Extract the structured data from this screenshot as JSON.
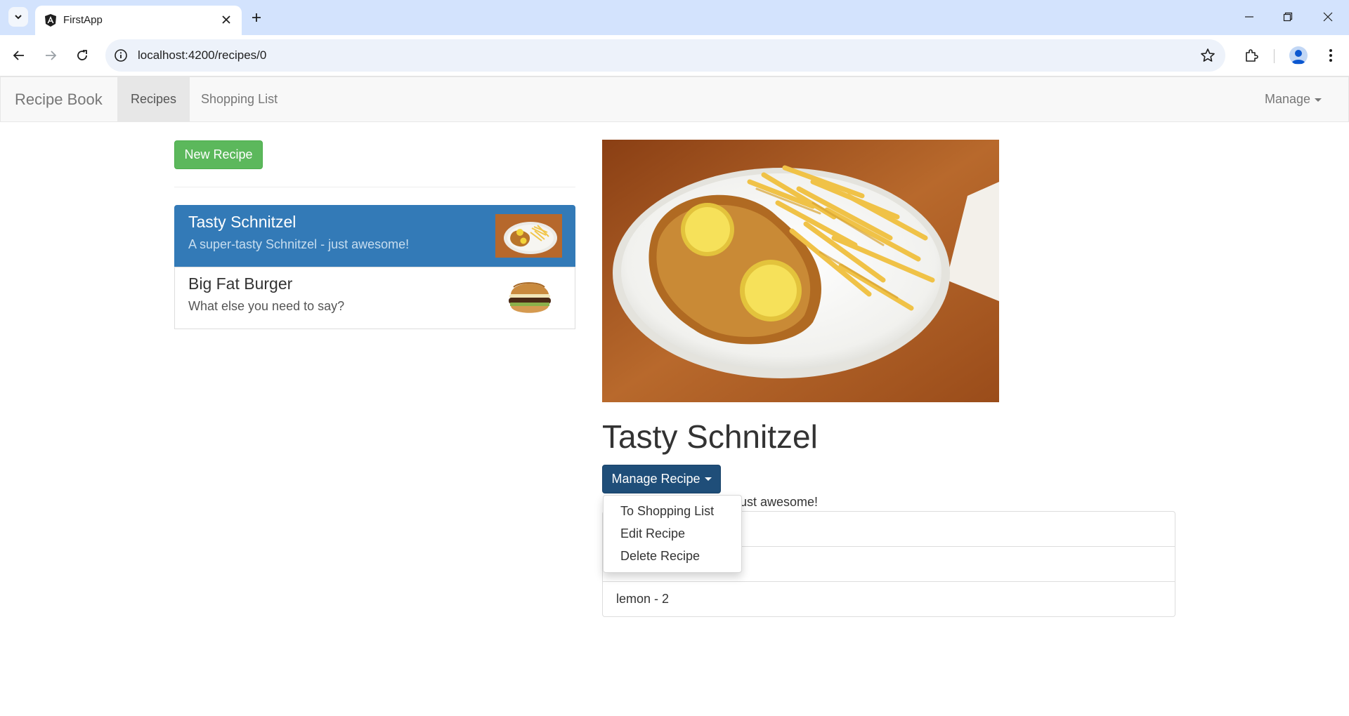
{
  "browser": {
    "tab_title": "FirstApp",
    "url": "localhost:4200/recipes/0"
  },
  "navbar": {
    "brand": "Recipe Book",
    "links": [
      "Recipes",
      "Shopping List"
    ],
    "active_link": "Recipes",
    "manage_label": "Manage"
  },
  "recipe_list": {
    "new_button": "New Recipe",
    "items": [
      {
        "name": "Tasty Schnitzel",
        "description": "A super-tasty Schnitzel - just awesome!",
        "active": true
      },
      {
        "name": "Big Fat Burger",
        "description": "What else you need to say?",
        "active": false
      }
    ]
  },
  "detail": {
    "name": "Tasty Schnitzel",
    "manage_button": "Manage Recipe",
    "description_visible": "ust awesome!",
    "ingredients": [
      "",
      "",
      "lemon - 2"
    ],
    "dropdown": [
      "To Shopping List",
      "Edit Recipe",
      "Delete Recipe"
    ]
  },
  "colors": {
    "primary": "#337ab7",
    "success": "#5cb85c",
    "manage_button": "#1f4e79",
    "navbar_bg": "#f8f8f8"
  }
}
